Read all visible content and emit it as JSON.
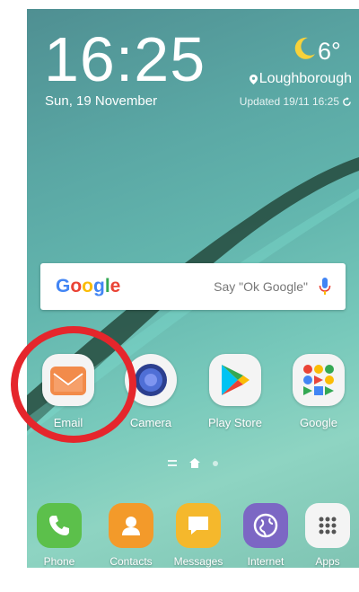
{
  "status": {
    "time": "16:25",
    "date": "Sun, 19 November"
  },
  "weather": {
    "temperature": "6°",
    "location": "Loughborough",
    "updated": "Updated 19/11  16:25",
    "icon": "crescent-moon-icon",
    "icon_color": "#f8d23a"
  },
  "search": {
    "brand": "Google",
    "hint": "Say \"Ok Google\"",
    "mic_icon": "microphone-icon"
  },
  "home_apps": [
    {
      "label": "Email",
      "icon": "email-icon",
      "color": "#f28b4a"
    },
    {
      "label": "Camera",
      "icon": "camera-icon",
      "color": "#4f6fd6"
    },
    {
      "label": "Play Store",
      "icon": "play-store-icon",
      "color": "#34a853"
    },
    {
      "label": "Google",
      "icon": "google-folder-icon",
      "color": "#ffffff"
    }
  ],
  "pager": {
    "active_page": "home"
  },
  "dock_apps": [
    {
      "label": "Phone",
      "icon": "phone-icon",
      "color": "#5cc04b"
    },
    {
      "label": "Contacts",
      "icon": "contacts-icon",
      "color": "#f39a2a"
    },
    {
      "label": "Messages",
      "icon": "messages-icon",
      "color": "#f5b82c"
    },
    {
      "label": "Internet",
      "icon": "internet-icon",
      "color": "#7c67c4"
    },
    {
      "label": "Apps",
      "icon": "apps-grid-icon",
      "color": "#ffffff"
    }
  ],
  "annotation": {
    "highlight_color": "#e5262c",
    "highlighted_app": "Email"
  }
}
